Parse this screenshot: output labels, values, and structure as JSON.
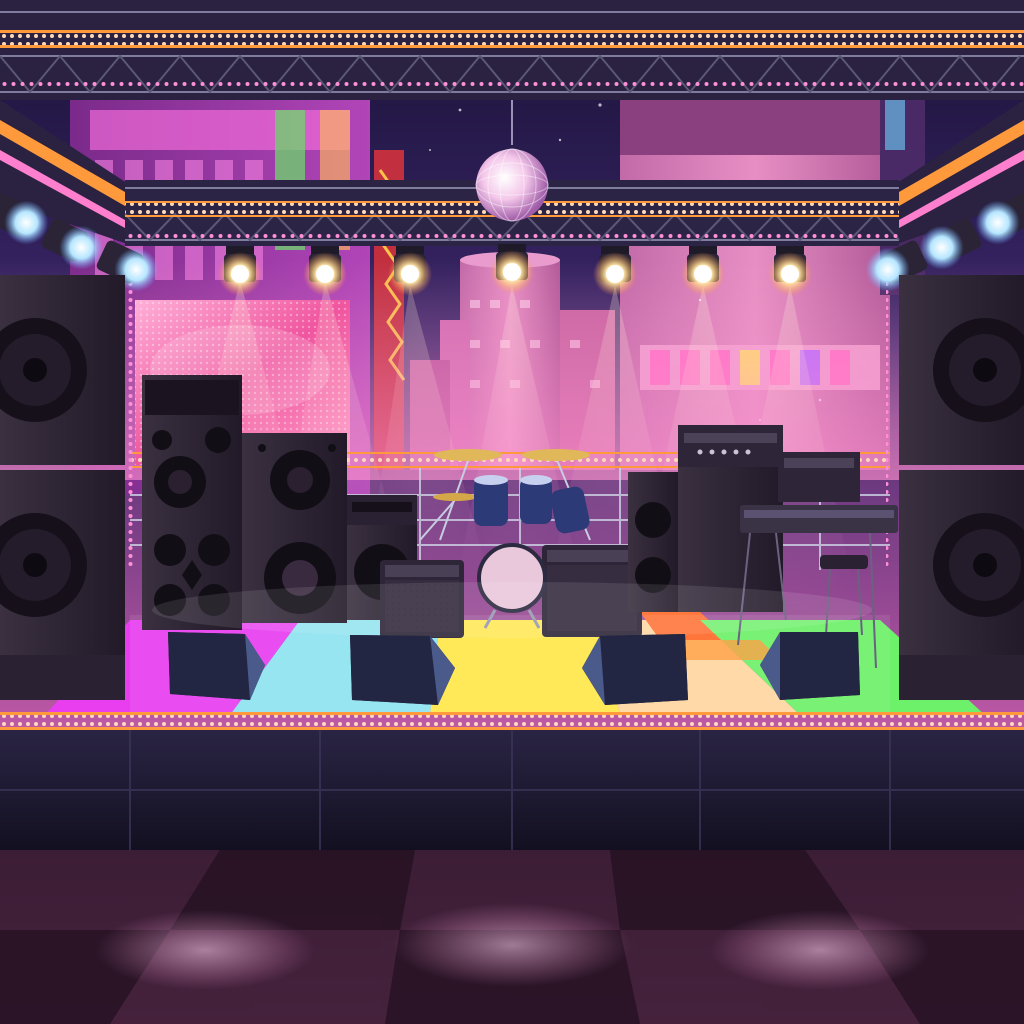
{
  "scene": {
    "type": "concert-stage-background",
    "elements": [
      "truss-frame",
      "marquee-light-strips",
      "disco-ball",
      "spotlights",
      "city-skyline-backdrop",
      "led-screen",
      "speaker-stacks",
      "drum-kit",
      "guitar-amplifiers",
      "keyboard",
      "stage-monitors",
      "rainbow-stage-floor",
      "checkered-audience-floor"
    ]
  },
  "colors": {
    "neon_orange": "#ff9a3c",
    "neon_pink": "#ff4fb8",
    "sky": "#231646",
    "backdrop_pink": "#f27fbf",
    "floor_magenta": "#e83ef0",
    "floor_cyan": "#8fe3f0",
    "floor_yellow": "#ffe84a",
    "floor_orange": "#ff9a3a",
    "floor_green": "#6df06a",
    "speaker_dark": "#2a2030"
  },
  "spotlights": {
    "top_count": 7,
    "side_count_each": 3
  },
  "monitors": {
    "count": 4
  }
}
